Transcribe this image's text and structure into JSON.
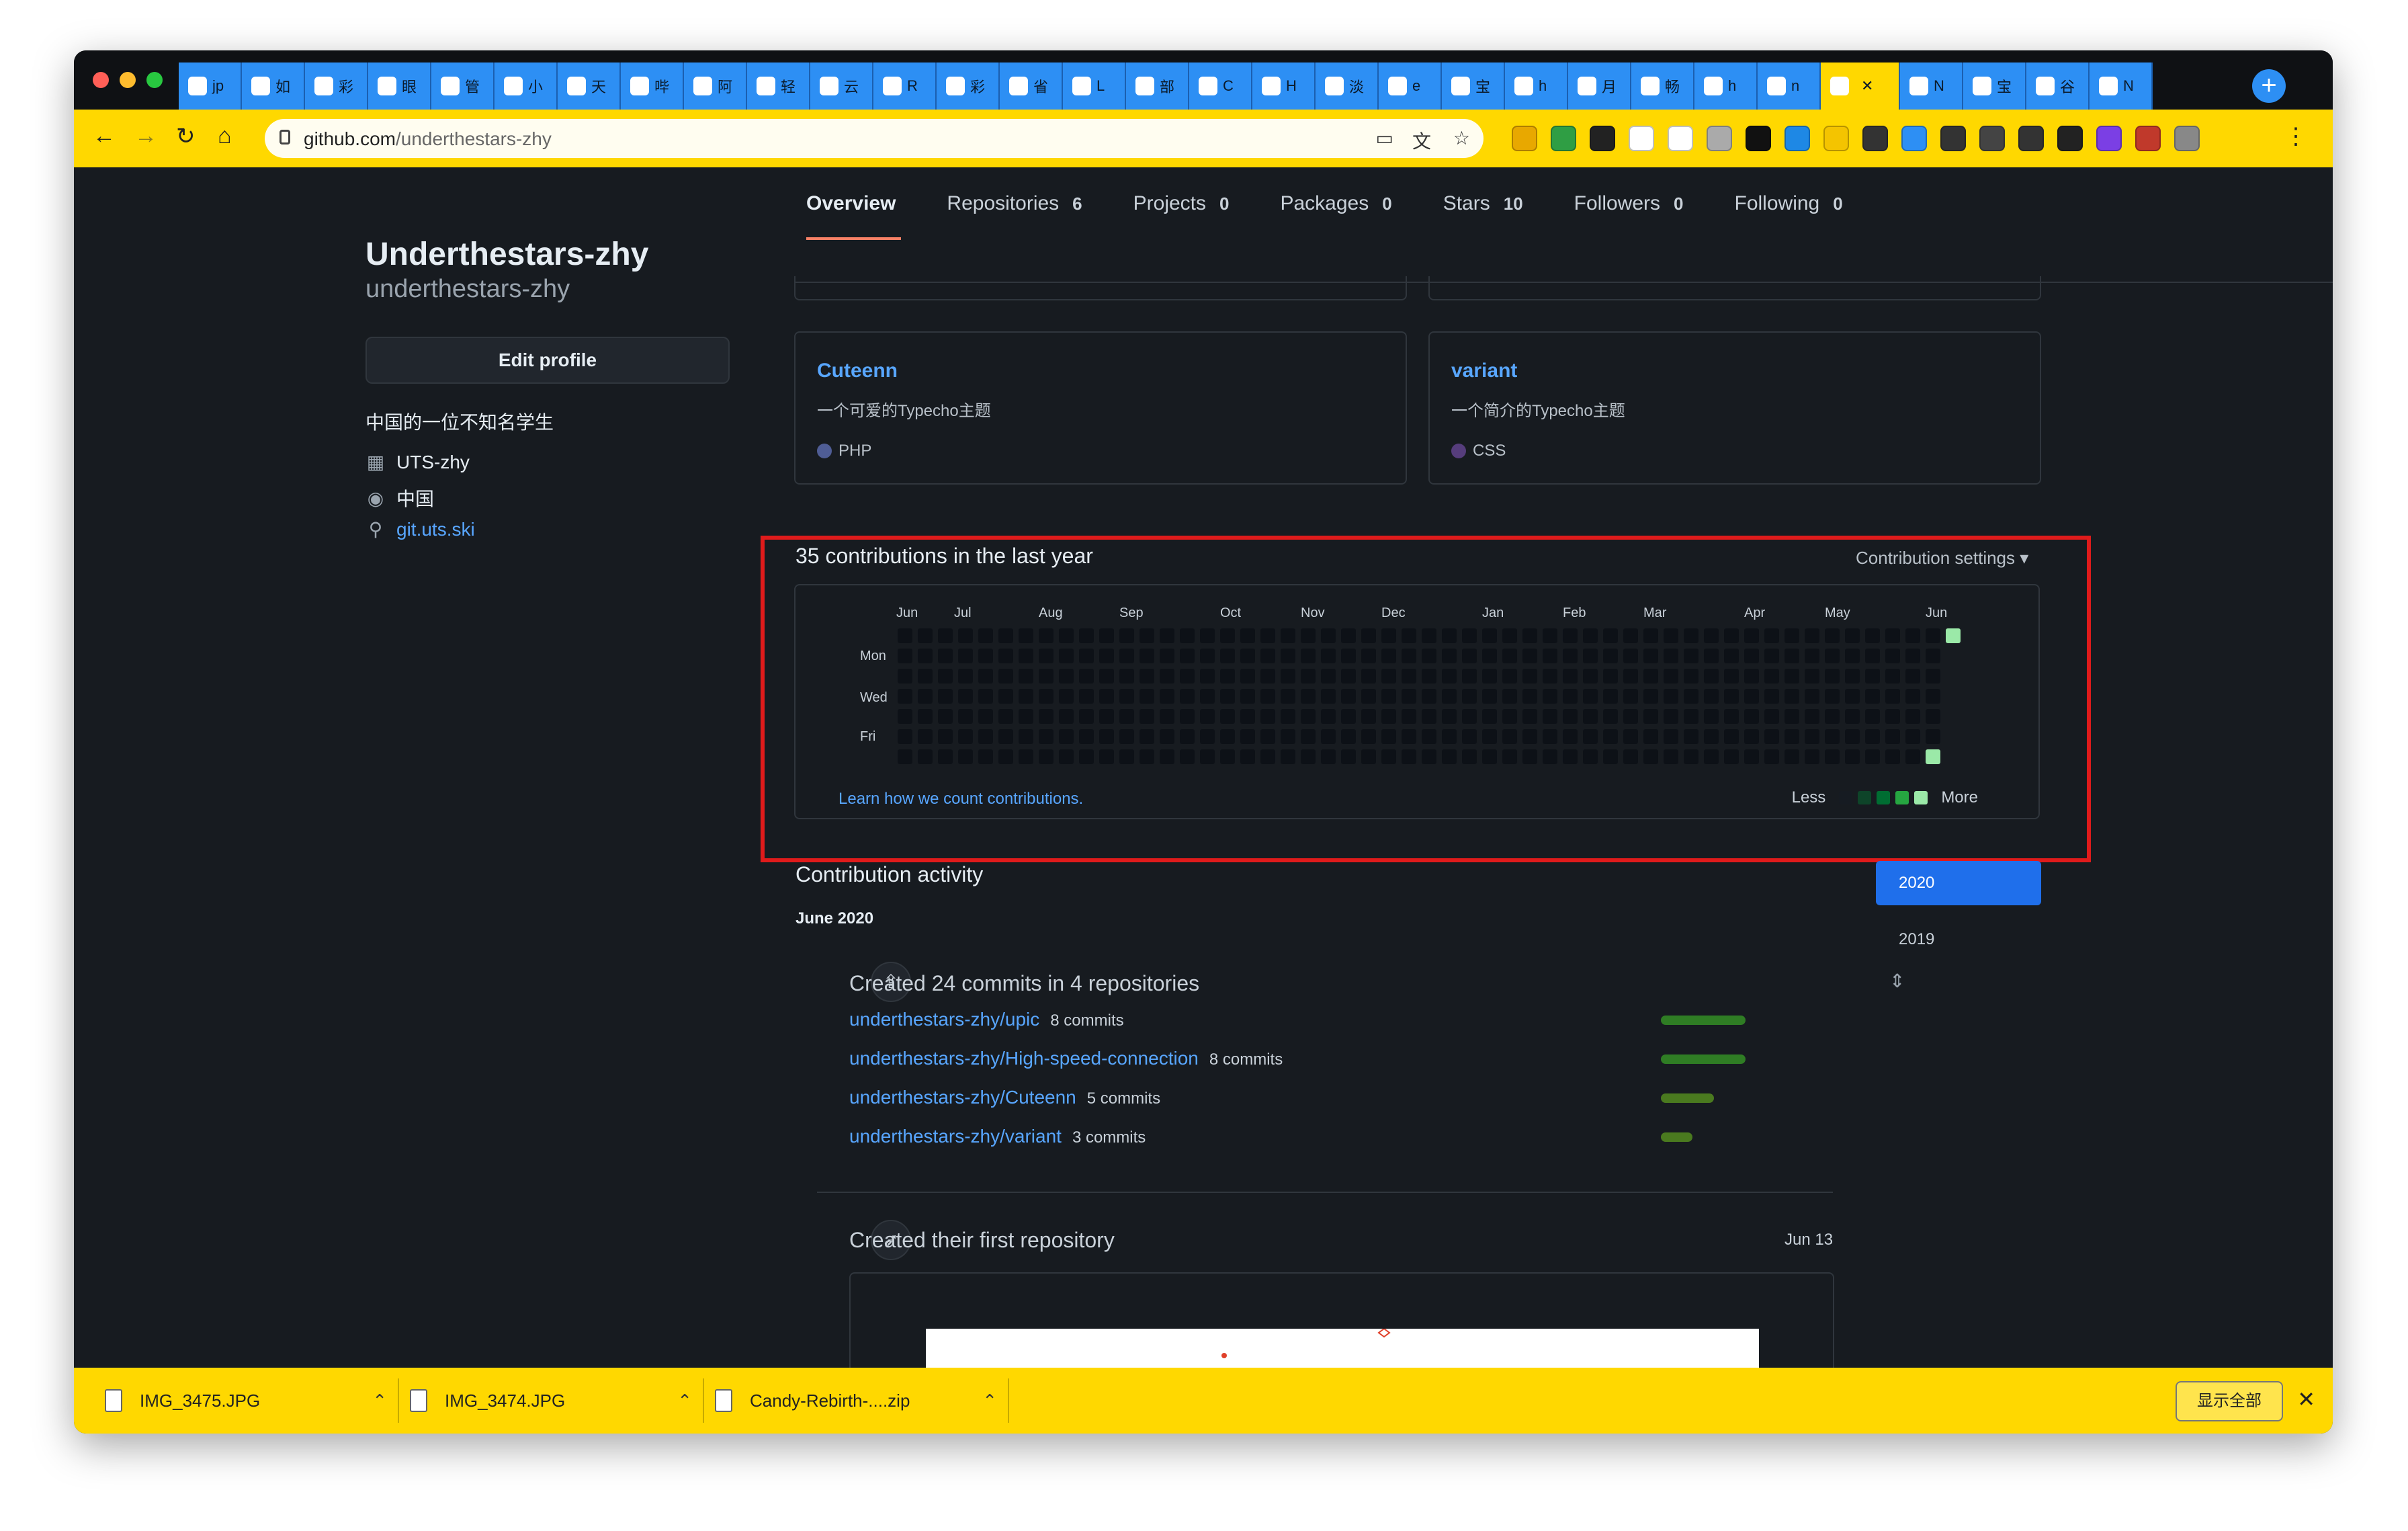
{
  "browser": {
    "tabs": [
      {
        "label": "jp",
        "color": "#2d8ff4"
      },
      {
        "label": "如",
        "color": "#2d8ff4"
      },
      {
        "label": "彩",
        "color": "#2d8ff4"
      },
      {
        "label": "眼",
        "color": "#2d8ff4"
      },
      {
        "label": "管",
        "color": "#2d8ff4"
      },
      {
        "label": "小",
        "color": "#2d8ff4"
      },
      {
        "label": "天",
        "color": "#2d8ff4"
      },
      {
        "label": "哔",
        "color": "#2d8ff4"
      },
      {
        "label": "阿",
        "color": "#2d8ff4"
      },
      {
        "label": "轻",
        "color": "#2d8ff4"
      },
      {
        "label": "云",
        "color": "#2d8ff4"
      },
      {
        "label": "R",
        "color": "#2d8ff4"
      },
      {
        "label": "彩",
        "color": "#2d8ff4"
      },
      {
        "label": "省",
        "color": "#2d8ff4"
      },
      {
        "label": "L",
        "color": "#2d8ff4"
      },
      {
        "label": "部",
        "color": "#2d8ff4"
      },
      {
        "label": "C",
        "color": "#2d8ff4"
      },
      {
        "label": "H",
        "color": "#2d8ff4"
      },
      {
        "label": "淡",
        "color": "#2d8ff4"
      },
      {
        "label": "e",
        "color": "#2d8ff4"
      },
      {
        "label": "宝",
        "color": "#2d8ff4"
      },
      {
        "label": "h",
        "color": "#2d8ff4"
      },
      {
        "label": "月",
        "color": "#2d8ff4"
      },
      {
        "label": "畅",
        "color": "#2d8ff4"
      },
      {
        "label": "h",
        "color": "#2d8ff4"
      },
      {
        "label": "n",
        "color": "#2d8ff4"
      },
      {
        "label": "",
        "color": "#ffd800",
        "active": true
      },
      {
        "label": "N",
        "color": "#2d8ff4"
      },
      {
        "label": "宝",
        "color": "#2d8ff4"
      },
      {
        "label": "谷",
        "color": "#2d8ff4"
      },
      {
        "label": "N",
        "color": "#2d8ff4"
      }
    ],
    "url_host": "github.com",
    "url_path": "/underthestars-zhy"
  },
  "profile": {
    "name": "Underthestars-zhy",
    "login": "underthestars-zhy",
    "edit_button": "Edit profile",
    "bio": "中国的一位不知名学生",
    "organization": "UTS-zhy",
    "location": "中国",
    "website": "git.uts.ski"
  },
  "nav": [
    {
      "label": "Overview",
      "count": ""
    },
    {
      "label": "Repositories",
      "count": "6"
    },
    {
      "label": "Projects",
      "count": "0"
    },
    {
      "label": "Packages",
      "count": "0"
    },
    {
      "label": "Stars",
      "count": "10"
    },
    {
      "label": "Followers",
      "count": "0"
    },
    {
      "label": "Following",
      "count": "0"
    }
  ],
  "pinned": [
    {
      "name": "Cuteenn",
      "description": "一个可爱的Typecho主题",
      "language": "PHP",
      "lang_color": "#4f5d95"
    },
    {
      "name": "variant",
      "description": "一个简介的Typecho主题",
      "language": "CSS",
      "lang_color": "#563d7c"
    }
  ],
  "contributions": {
    "title": "35 contributions in the last year",
    "settings_label": "Contribution settings ▾",
    "months": [
      "Jun",
      "Jul",
      "Aug",
      "Sep",
      "Oct",
      "Nov",
      "Dec",
      "Jan",
      "Feb",
      "Mar",
      "Apr",
      "May",
      "Jun"
    ],
    "days": [
      "Mon",
      "Wed",
      "Fri"
    ],
    "learn_link": "Learn how we count contributions.",
    "legend_less": "Less",
    "legend_more": "More",
    "legend_colors": [
      "#161b22",
      "#0e4429",
      "#006d32",
      "#26a641",
      "#9be9a8"
    ],
    "highlight_color": "#e01b1b"
  },
  "activity": {
    "title": "Contribution activity",
    "month": "June 2020",
    "years": [
      "2020",
      "2019"
    ],
    "commits_event": "Created 24 commits in 4 repositories",
    "repos": [
      {
        "name": "underthestars-zhy/upic",
        "commits": "8 commits",
        "share": 1.0
      },
      {
        "name": "underthestars-zhy/High-speed-connection",
        "commits": "8 commits",
        "share": 1.0
      },
      {
        "name": "underthestars-zhy/Cuteenn",
        "commits": "5 commits",
        "share": 0.625
      },
      {
        "name": "underthestars-zhy/variant",
        "commits": "3 commits",
        "share": 0.375
      }
    ],
    "first_repo_event": "Created their first repository",
    "first_repo_date": "Jun 13"
  },
  "downloads": {
    "items": [
      "IMG_3475.JPG",
      "IMG_3474.JPG",
      "Candy-Rebirth-....zip"
    ],
    "show_all": "显示全部"
  }
}
